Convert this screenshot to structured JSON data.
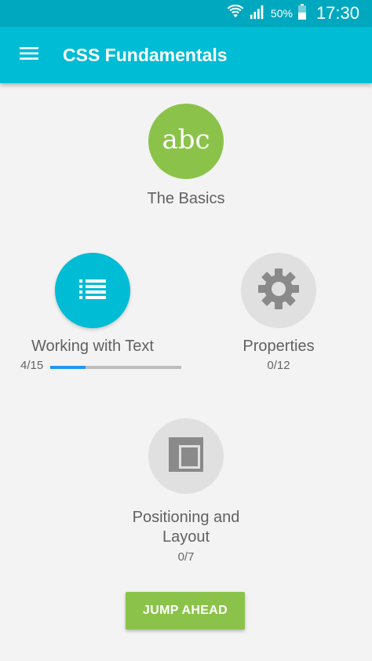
{
  "status_bar": {
    "battery_percent": "50%",
    "time": "17:30",
    "icons": [
      "wifi-icon",
      "signal-icon",
      "battery-icon"
    ]
  },
  "app_bar": {
    "menu_icon": "menu-icon",
    "title": "CSS Fundamentals",
    "color": "#00bcd4"
  },
  "lessons": [
    {
      "title": "The Basics",
      "icon": "abc",
      "icon_text": "abc",
      "color": "#8bc34a"
    },
    {
      "title": "Working with Text",
      "icon": "list-icon",
      "progress": "4/15",
      "progress_fraction": 0.2667,
      "color": "#00bcd4"
    },
    {
      "title": "Properties",
      "icon": "gear-icon",
      "progress": "0/12",
      "color": "#e0e0e0"
    },
    {
      "title": "Positioning and Layout",
      "icon": "layout-icon",
      "progress": "0/7",
      "color": "#e0e0e0"
    }
  ],
  "jump_ahead_label": "JUMP AHEAD",
  "accent_green": "#8bc34a",
  "progress_color": "#2196f3"
}
